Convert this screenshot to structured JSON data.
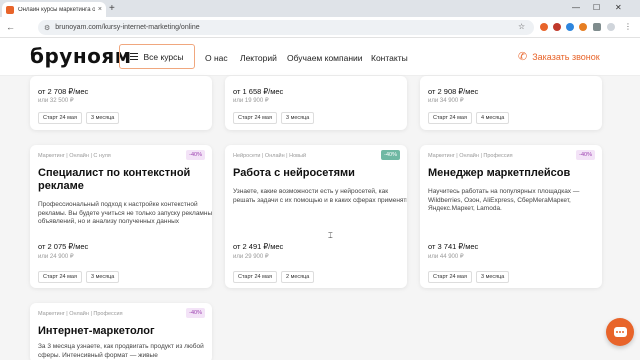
{
  "browser": {
    "tab_title": "Онлайн курсы маркетинга от...",
    "tab_close": "×",
    "new_tab": "+",
    "url": "brunoyam.com/kursy-internet-marketing/online",
    "win_minimize": "—",
    "win_maximize": "☐",
    "win_close": "✕",
    "back": "←",
    "forward": "→",
    "reload": "↻",
    "site_info": "⚙",
    "star": "☆",
    "menu": "⋮"
  },
  "header": {
    "logo": "бруноям",
    "all_courses": "Все курсы",
    "nav": [
      "О нас",
      "Лекторий",
      "Обучаем компании",
      "Контакты"
    ],
    "call": "Заказать звонок",
    "accent": "#e8642a"
  },
  "cards_top": [
    {
      "price": "от 2 708 ₽/мес",
      "old_price": "или 32 500 ₽",
      "start": "Старт 24 мая",
      "duration": "3 месяца"
    },
    {
      "price": "от 1 658 ₽/мес",
      "old_price": "или 19 900 ₽",
      "start": "Старт 24 мая",
      "duration": "3 месяца"
    },
    {
      "price": "от 2 908 ₽/мес",
      "old_price": "или 34 900 ₽",
      "start": "Старт 24 мая",
      "duration": "4 месяца"
    }
  ],
  "cards_mid": [
    {
      "tags": "Маркетинг  |  Онлайн  |  С нуля",
      "badge": "-40%",
      "title": "Специалист по контекстной рекламе",
      "desc": "Профессиональный подход к настройке контекстной рекламы. Вы будете учиться не только запуску рекламных объявлений, но и анализу полученных данных",
      "price": "от 2 075 ₽/мес",
      "old_price": "или 24 900 ₽",
      "start": "Старт 24 мая",
      "duration": "3 месяца"
    },
    {
      "tags": "Нейросети  |  Онлайн  |  Новый",
      "badge": "-40%",
      "title": "Работа с нейросетями",
      "desc": "Узнаете, какие возможности есть у нейросетей, как решать задачи с их помощью и в каких сферах применять",
      "price": "от 2 491 ₽/мес",
      "old_price": "или 29 900 ₽",
      "start": "Старт 24 мая",
      "duration": "2 месяца"
    },
    {
      "tags": "Маркетинг  |  Онлайн  |  Профессия",
      "badge": "-40%",
      "title": "Менеджер маркетплейсов",
      "desc": "Научитесь работать на популярных площадках — Wildberries, Озон, AliExpress, СберМегаМаркет, Яндекс.Маркет, Lamoda.",
      "price": "от 3 741 ₽/мес",
      "old_price": "или 44 900 ₽",
      "start": "Старт 24 мая",
      "duration": "3 месяца"
    }
  ],
  "card_bottom": {
    "tags": "Маркетинг  |  Онлайн  |  Профессия",
    "badge": "-40%",
    "title": "Интернет-маркетолог",
    "desc": "За 3 месяца узнаете, как продвигать продукт из любой сферы. Интенсивный формат — живые"
  }
}
